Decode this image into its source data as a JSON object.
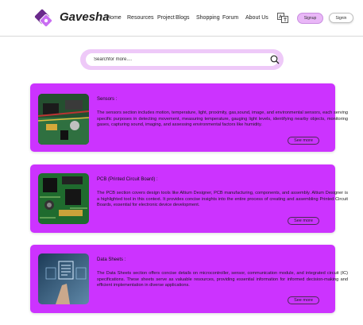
{
  "brand": {
    "name": "Gavesha"
  },
  "nav": [
    "Home",
    "Resources",
    "Project",
    "Blogs",
    "Shopping",
    "Forum",
    "About Us"
  ],
  "auth": {
    "signup": "Signup",
    "signin": "Signin"
  },
  "search": {
    "placeholder": "Searchfor more...."
  },
  "cards": [
    {
      "title": "Sensors :",
      "text": "The sensors section includes motion, temperature, light, proximity, gas,sound, image, and environmental sensors, each serving specific purposes in detecting movement, measuring temperature, gauging light levels, identifying nearby objects, monitoring gases, capturing sound, imaging, and assessing environmental factors like humidity.",
      "button": "See more"
    },
    {
      "title": "PCB (Printed Circuit Board) :",
      "text": "The PCB section covers design tools like Altium Designer, PCB manufacturing, components, and assembly. Altium Designer is a highlighted tool in this context. It provides concise insights into the entire process of creating and assembling Printed Circuit Boards, essential for electronic device development.",
      "button": "See more"
    },
    {
      "title": "Data Sheets :",
      "text": "The Data Sheets section offers concise details on microcontroller, sensor, communication module, and integrated circuit (IC) specifications. These sheets serve as valuable resources, providing essential information for informed decision-making and efficient implementation in diverse applications.",
      "button": "See more"
    }
  ],
  "colors": {
    "card": "#cc33ff",
    "search_outer": "#eec9f8",
    "signup_bg": "#e9b7f7"
  }
}
